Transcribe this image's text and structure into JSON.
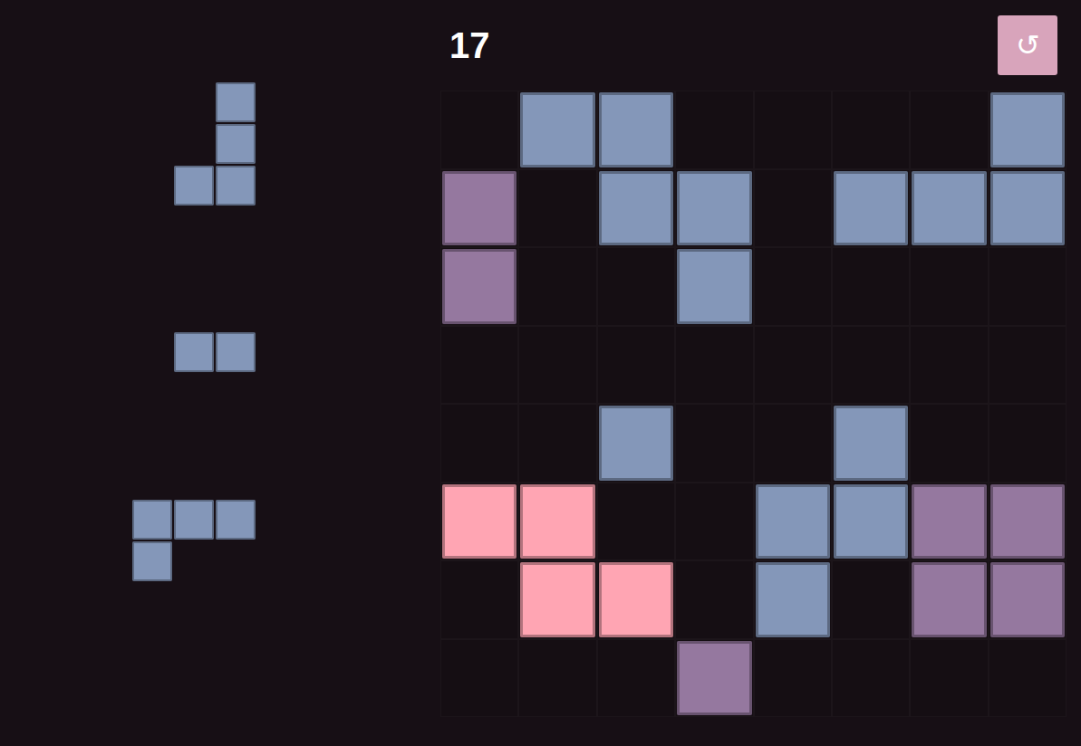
{
  "score": "17",
  "restart_button": {
    "label": "↺"
  },
  "pieces": [
    {
      "cells": [
        [
          false,
          true
        ],
        [
          false,
          true
        ],
        [
          true,
          true
        ]
      ],
      "color": "#8497b9"
    },
    {
      "cells": [
        [
          true,
          true
        ]
      ],
      "color": "#8497b9"
    },
    {
      "cells": [
        [
          true,
          true,
          true
        ],
        [
          true,
          false,
          false
        ]
      ],
      "color": "#8497b9"
    }
  ],
  "board": [
    [
      null,
      "#8497b9",
      "#8497b9",
      null,
      null,
      null,
      null,
      "#8497b9"
    ],
    [
      "#95789f",
      null,
      "#8497b9",
      "#8497b9",
      null,
      "#8497b9",
      "#8497b9",
      "#8497b9"
    ],
    [
      "#95789f",
      null,
      null,
      "#8497b9",
      null,
      null,
      null,
      null
    ],
    [
      null,
      null,
      null,
      null,
      null,
      null,
      null,
      null
    ],
    [
      null,
      null,
      "#8497b9",
      null,
      null,
      "#8497b9",
      null,
      null
    ],
    [
      "#ffa5b3",
      "#ffa5b3",
      null,
      null,
      "#8497b9",
      "#8497b9",
      "#95789f",
      "#95789f"
    ],
    [
      null,
      "#ffa5b3",
      "#ffa5b3",
      null,
      "#8497b9",
      null,
      "#95789f",
      "#95789f"
    ],
    [
      null,
      null,
      null,
      "#95789f",
      null,
      null,
      null,
      null
    ]
  ]
}
